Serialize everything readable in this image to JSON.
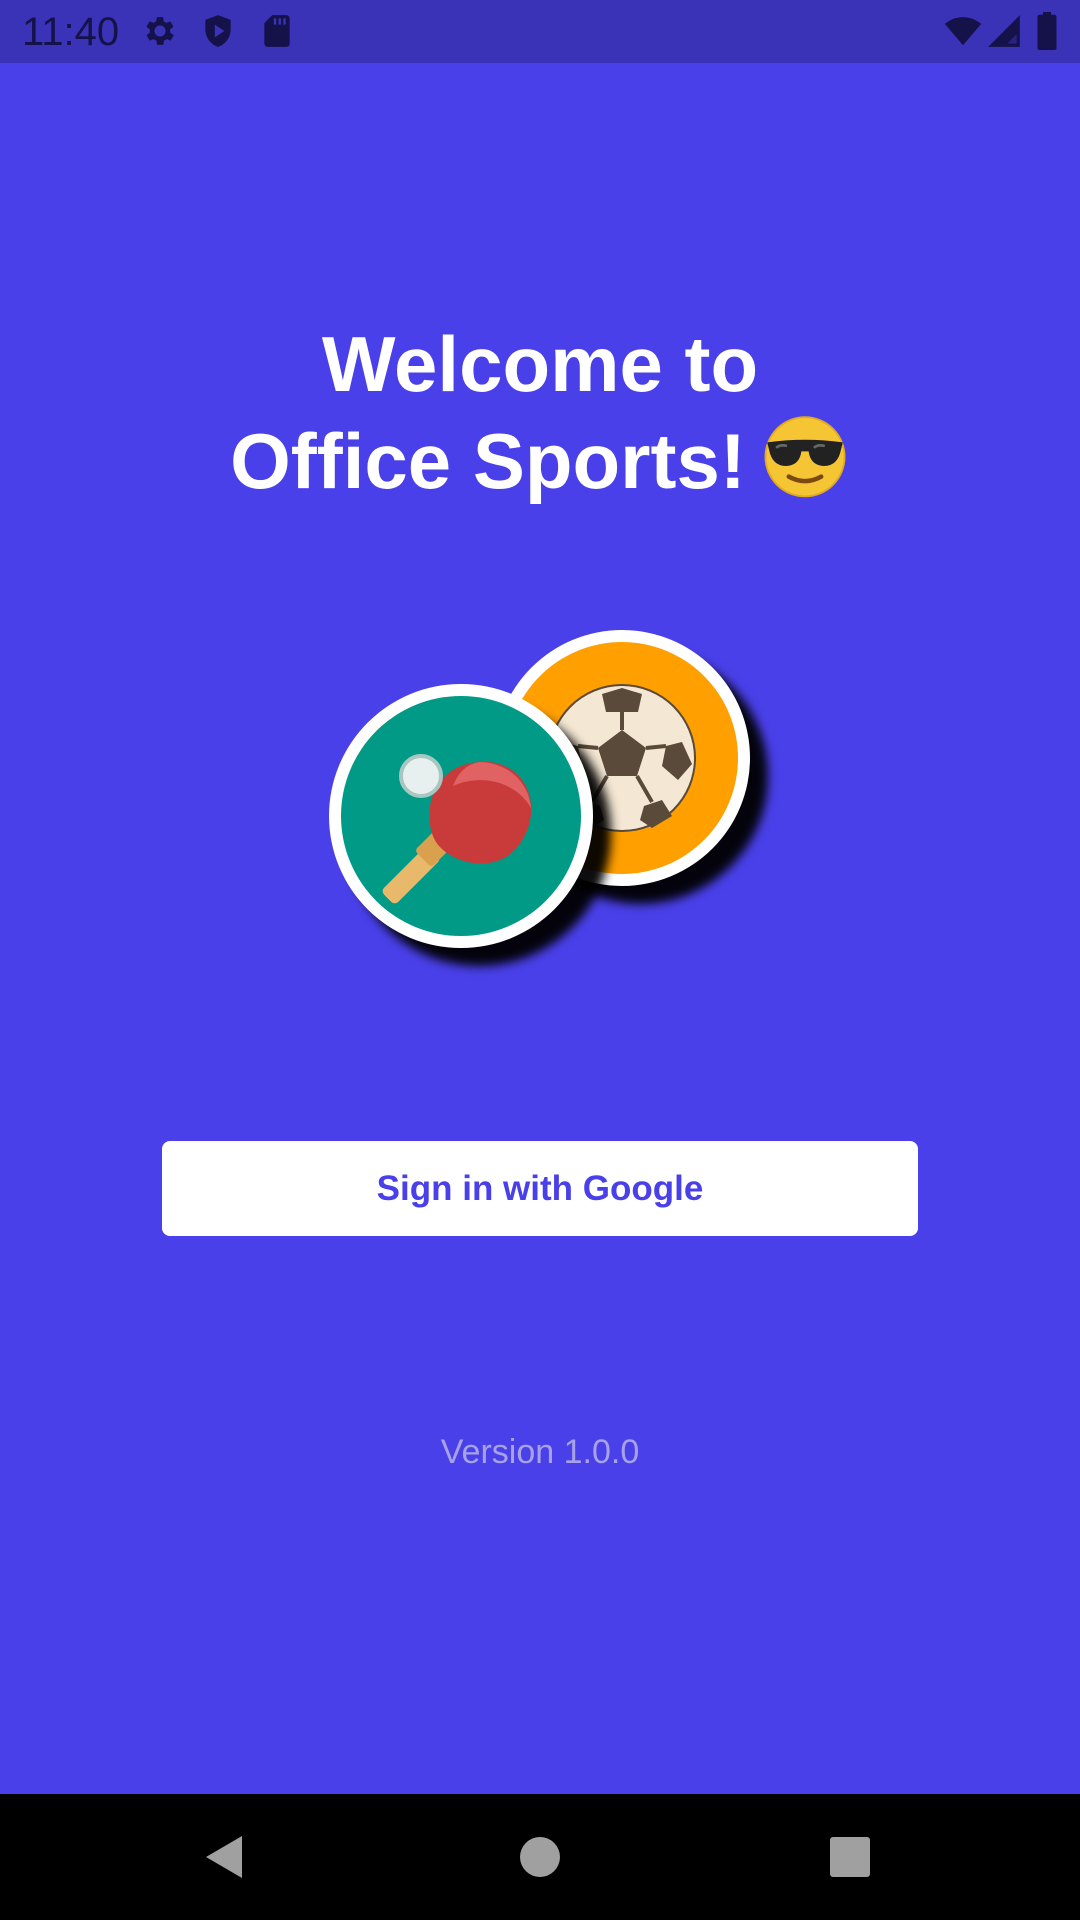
{
  "status_bar": {
    "time": "11:40",
    "left_icons": [
      "gear-icon",
      "shield-icon",
      "sd-card-icon"
    ],
    "right_icons": [
      "wifi-icon",
      "signal-icon",
      "battery-icon"
    ]
  },
  "welcome": {
    "line1": "Welcome to",
    "line2": "Office Sports!",
    "emoji": "smiling-face-with-sunglasses-emoji"
  },
  "sports": [
    {
      "name": "soccer",
      "icon": "soccer-ball-icon",
      "color": "#FF9F00"
    },
    {
      "name": "table-tennis",
      "icon": "ping-pong-paddle-icon",
      "color": "#009A87"
    }
  ],
  "signin": {
    "label": "Sign in with Google"
  },
  "version": {
    "text": "Version 1.0.0"
  },
  "nav_bar": {
    "buttons": [
      "back-icon",
      "home-icon",
      "recents-icon"
    ]
  },
  "colors": {
    "background": "#4A40EA",
    "status_bar": "#3A33B8",
    "button_background": "#FFFFFF",
    "button_text": "#4A40EA",
    "version_text": "#A7A2E6"
  }
}
